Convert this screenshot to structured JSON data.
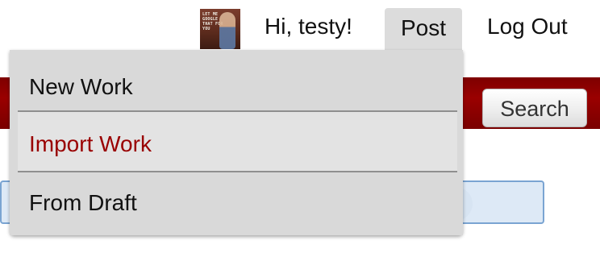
{
  "user_bar": {
    "avatar_caption": "LET ME GOOGLE THAT FOR YOU",
    "greeting": "Hi, testy!",
    "post_label": "Post",
    "logout_label": "Log Out"
  },
  "post_menu": {
    "items": [
      {
        "label": "New Work",
        "state": "normal"
      },
      {
        "label": "Import Work",
        "state": "hover"
      },
      {
        "label": "From Draft",
        "state": "normal"
      }
    ]
  },
  "search": {
    "button_label": "Search"
  },
  "colors": {
    "header_red": "#990000",
    "menu_bg": "#d9d9d9",
    "highlight_text": "#990000"
  }
}
